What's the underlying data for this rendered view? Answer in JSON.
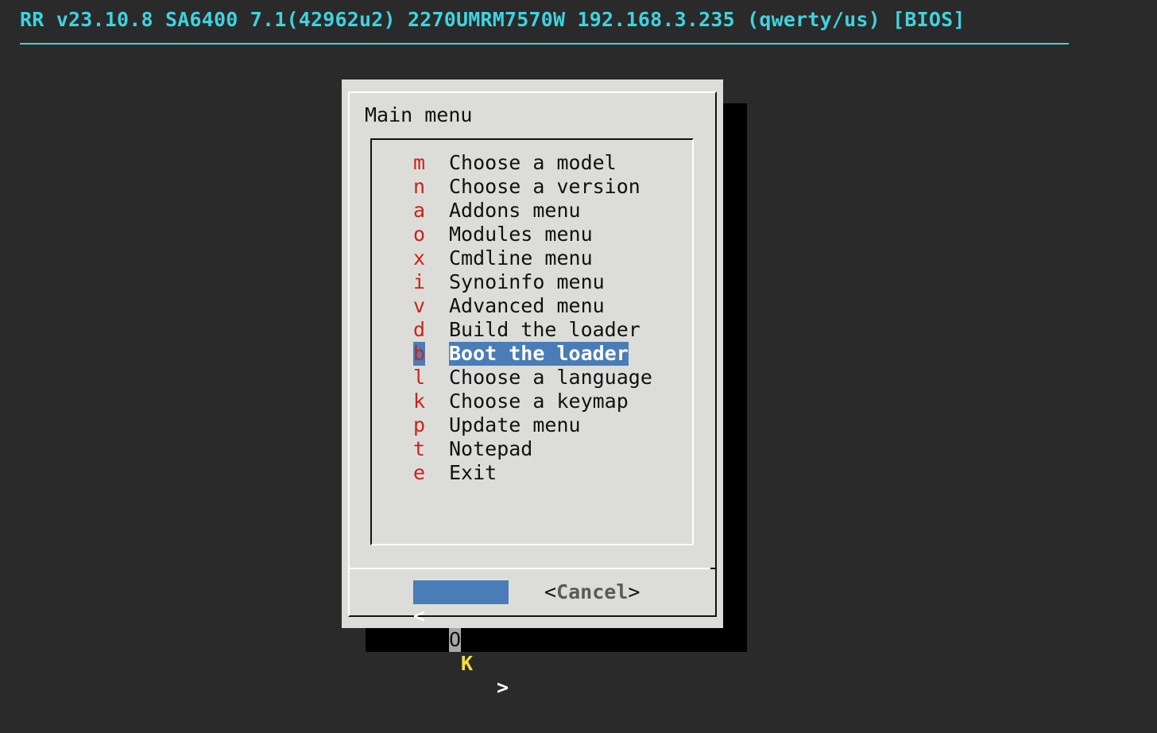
{
  "backtitle": "RR v23.10.8 SA6400 7.1(42962u2) 2270UMRM7570W 192.168.3.235 (qwerty/us) [BIOS]",
  "dialog": {
    "title": "Main menu",
    "menu": [
      {
        "key": "m",
        "label": "Choose a model"
      },
      {
        "key": "n",
        "label": "Choose a version"
      },
      {
        "key": "a",
        "label": "Addons menu"
      },
      {
        "key": "o",
        "label": "Modules menu"
      },
      {
        "key": "x",
        "label": "Cmdline menu"
      },
      {
        "key": "i",
        "label": "Synoinfo menu"
      },
      {
        "key": "v",
        "label": "Advanced menu"
      },
      {
        "key": "d",
        "label": "Build the loader"
      },
      {
        "key": "b",
        "label": "Boot the loader",
        "selected": true
      },
      {
        "key": "l",
        "label": "Choose a language"
      },
      {
        "key": "k",
        "label": "Choose a keymap"
      },
      {
        "key": "p",
        "label": "Update menu"
      },
      {
        "key": "t",
        "label": "Notepad"
      },
      {
        "key": "e",
        "label": "Exit"
      }
    ],
    "buttons": {
      "ok": {
        "left": "<",
        "o": "O",
        "k": "K",
        "right": ">"
      },
      "cancel": {
        "left": "<",
        "label": "Cancel",
        "right": ">"
      }
    }
  },
  "colors": {
    "background": "#2a2a2a",
    "backtitle": "#3fd2df",
    "dialog": "#dcddd8",
    "hotkey": "#c9231b",
    "selection": "#4a7db8",
    "ok_hotkey": "#f3e13a"
  }
}
